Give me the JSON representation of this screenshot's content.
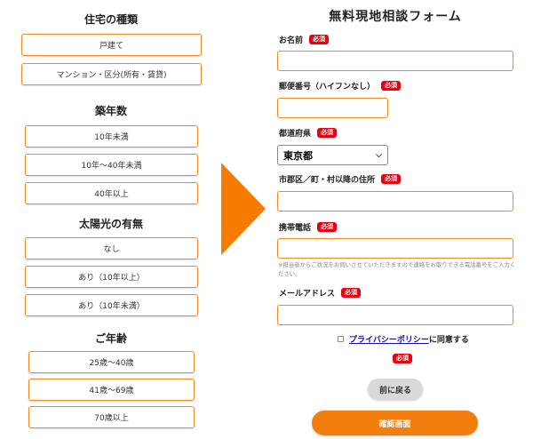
{
  "left": {
    "housing_type": {
      "title": "住宅の種類",
      "options": [
        "戸建て",
        "マンション・区分(所有・賃貸)"
      ]
    },
    "building_age": {
      "title": "築年数",
      "options": [
        "10年未満",
        "10年〜40年未満",
        "40年以上"
      ]
    },
    "solar": {
      "title": "太陽光の有無",
      "options": [
        "なし",
        "あり（10年以上）",
        "あり（10年未満）"
      ]
    },
    "age": {
      "title": "ご年齢",
      "options": [
        "25歳〜40歳",
        "41歳〜69歳",
        "70歳以上"
      ]
    }
  },
  "form": {
    "title": "無料現地相談フォーム",
    "required_badge": "必須",
    "name_label": "お名前",
    "postal_label": "郵便番号（ハイフンなし）",
    "prefecture_label": "都道府県",
    "prefecture_value": "東京都",
    "city_label": "市郡区／町・村以降の住所",
    "phone_label": "携帯電話",
    "phone_note": "※担当者からご状況をお伺いさせていただきますので連絡をお取りできる電話番号をご入力ください。",
    "email_label": "メールアドレス",
    "privacy_link": "プライバシーポリシー",
    "privacy_suffix": "に同意する",
    "back_button": "前に戻る",
    "confirm_button": "確認画面"
  },
  "colors": {
    "accent": "#f08a24",
    "arrow": "#f57c00",
    "required": "#e60012",
    "button_confirm": "#f17e0d",
    "button_back": "#d9d9d9"
  }
}
